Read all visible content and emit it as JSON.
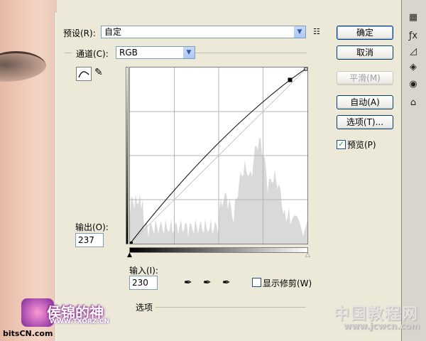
{
  "preset": {
    "label": "预设(R):",
    "value": "自定"
  },
  "channel": {
    "label": "通道(C):",
    "value": "RGB"
  },
  "buttons": {
    "ok": "确定",
    "cancel": "取消",
    "smooth": "平滑(M)",
    "auto": "自动(A)",
    "options": "选项(T)..."
  },
  "preview": {
    "label": "预览(P)",
    "checked": true
  },
  "output": {
    "label": "输出(O):",
    "value": "237"
  },
  "input": {
    "label": "输入(I):",
    "value": "230"
  },
  "show_clipping": {
    "label": "显示修剪(W)",
    "checked": false
  },
  "curve_options_label": "选项",
  "curve": {
    "point_in": 230,
    "point_out": 237
  },
  "watermarks": {
    "left_title": "侯锦的神",
    "left_url": "WWW.TXORZ.CN",
    "bottom_left": "bitsCN.com",
    "right_title": "中国教程网",
    "right_url": "www.jcwcn.com"
  },
  "colors": {
    "focus_border": "#003c74",
    "checkbox_check": "#21a121"
  }
}
